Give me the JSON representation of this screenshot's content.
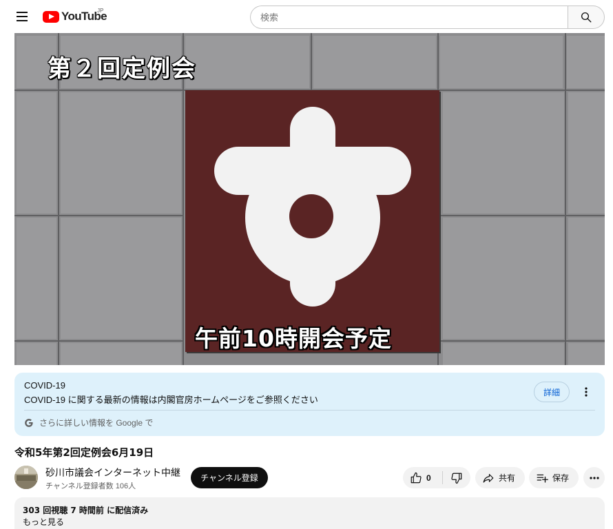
{
  "header": {
    "logo_text": "YouTube",
    "region": "JP",
    "search_placeholder": "検索"
  },
  "video": {
    "overlay_title": "第２回定例会",
    "overlay_bottom": "午前10時開会予定"
  },
  "info_panel": {
    "title": "COVID-19",
    "text": "COVID-19 に関する最新の情報は内閣官房ホームページをご参照ください",
    "detail_label": "詳細",
    "source_text": "さらに詳しい情報を Google で"
  },
  "video_title": "令和5年第2回定例会6月19日",
  "channel": {
    "name": "砂川市議会インターネット中継",
    "subscribers": "チャンネル登録者数 106人",
    "subscribe_label": "チャンネル登録"
  },
  "actions": {
    "like_count": "0",
    "share_label": "共有",
    "save_label": "保存"
  },
  "description": {
    "meta": "303 回視聴  7 時間前 に配信済み",
    "more_label": "もっと見る"
  }
}
